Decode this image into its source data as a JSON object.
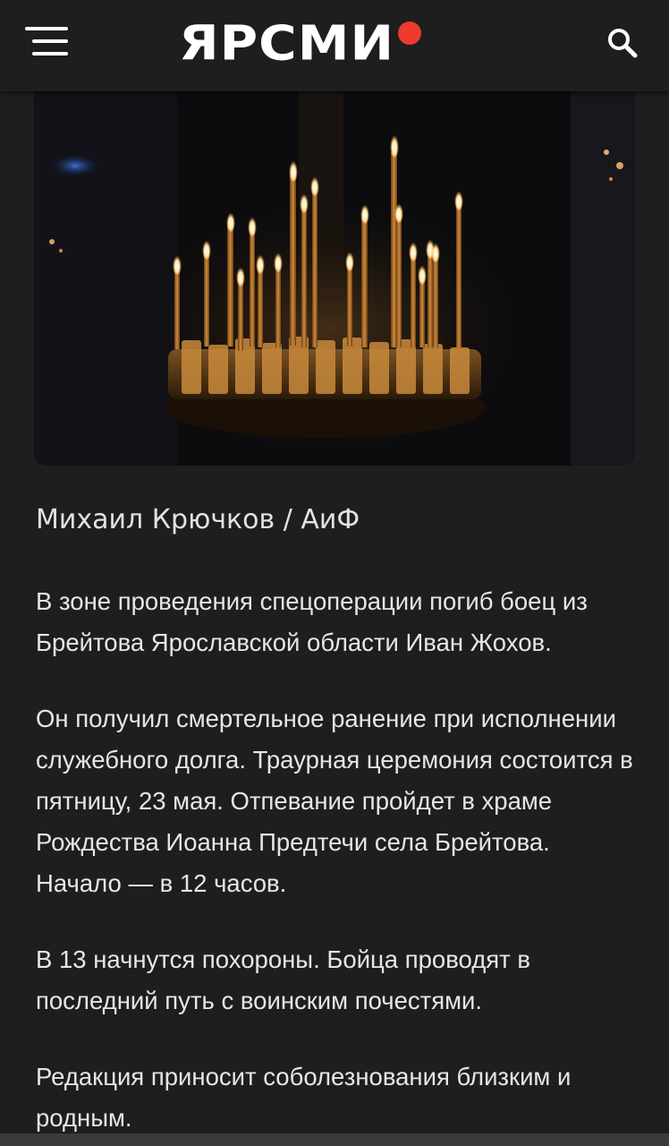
{
  "header": {
    "logo_text": "ЯРСМИ",
    "brand_accent": "#ee3a2f",
    "menu_icon": "hamburger-menu-icon",
    "search_icon": "search-icon"
  },
  "article": {
    "image_caption": "Михаил Крючков / АиФ",
    "paragraphs": [
      "В зоне проведения спецоперации погиб боец из Брейтова Ярославской области Иван Жохов.",
      "Он получил смертельное ранение при исполнении служебного долга. Траурная церемония состоится в пятницу, 23 мая. Отпевание пройдет в храме Рождества Иоанна Предтечи села Брейтова. Начало — в 12 часов.",
      "В 13 начнутся похороны. Бойца проводят в последний путь с воинским почестями.",
      "Редакция приносит соболезнования близким и родным."
    ]
  },
  "colors": {
    "background": "#1e1e1e",
    "text": "#e6e6e6"
  }
}
